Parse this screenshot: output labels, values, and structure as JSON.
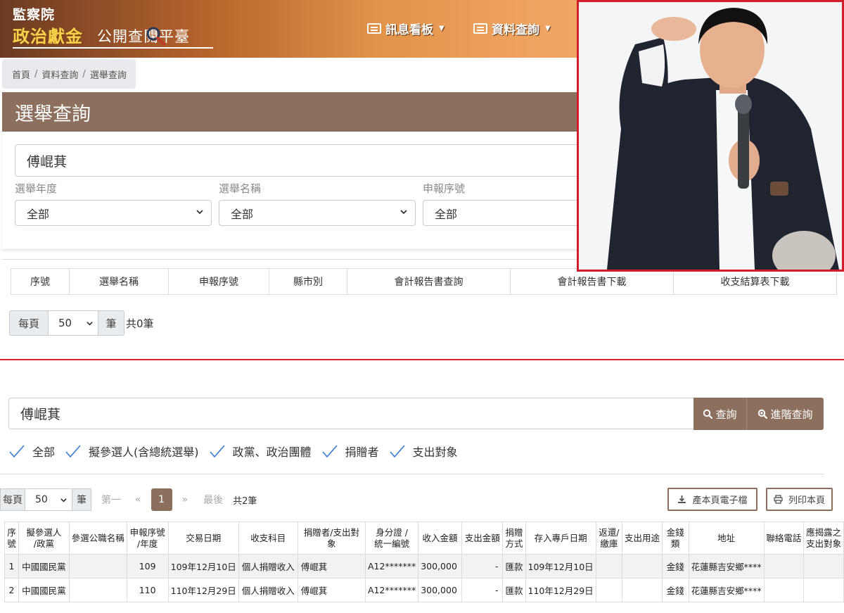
{
  "site": {
    "org": "監察院",
    "title_main": "政治獻金",
    "title_sub": "公開查閱平臺",
    "nav": [
      {
        "label": "訊息看板"
      },
      {
        "label": "資料查詢"
      }
    ]
  },
  "breadcrumb": [
    "首頁",
    "資料查詢",
    "選舉查詢"
  ],
  "election_page": {
    "title": "選舉查詢",
    "search_value": "傅崐萁",
    "filters": [
      {
        "label": "選舉年度",
        "value": "全部"
      },
      {
        "label": "選舉名稱",
        "value": "全部"
      },
      {
        "label": "申報序號",
        "value": "全部"
      }
    ],
    "table_headers": [
      "序號",
      "選舉名稱",
      "申報序號",
      "縣市別",
      "會計報告書查詢",
      "會計報告書下載",
      "收支結算表下載"
    ],
    "pager": {
      "per_page_label": "每頁",
      "per_page_value": "50",
      "unit": "筆",
      "total": "共0筆"
    }
  },
  "photo": {
    "description_icon": "portrait-photo"
  },
  "detail_page": {
    "search_value": "傅崐萁",
    "buttons": {
      "query": "查詢",
      "advanced": "進階查詢",
      "export": "產本頁電子檔",
      "print": "列印本頁"
    },
    "checks": [
      "全部",
      "擬參選人(含總統選舉)",
      "政黨、政治團體",
      "捐贈者",
      "支出對象"
    ],
    "pager": {
      "per_page_label": "每頁",
      "per_page_value": "50",
      "unit": "筆",
      "first": "第一",
      "prev": "«",
      "current": "1",
      "next": "»",
      "last": "最後",
      "total": "共2筆"
    },
    "table_headers": [
      "序\n號",
      "擬參選人\n/政黨",
      "參選公職名稱",
      "申報序號\n/年度",
      "交易日期",
      "收支科目",
      "捐贈者/支出對象",
      "身分證 /\n統一編號",
      "收入金額",
      "支出金額",
      "捐贈\n方式",
      "存入專戶日期",
      "返還/\n繳庫",
      "支出用途",
      "金錢\n類",
      "地址",
      "聯絡電話",
      "應揭露之\n支出對象"
    ],
    "rows": [
      {
        "no": "1",
        "party": "中國國民黨",
        "office": "",
        "serial": "109",
        "date": "109年12月10日",
        "subject": "個人捐贈收入",
        "donor": "傅崐萁",
        "id": "A12*******",
        "income": "300,000",
        "expense": "-",
        "method": "匯款",
        "deposit_date": "109年12月10日",
        "returned": "",
        "purpose": "",
        "money_type": "金錢",
        "address": "花蓮縣吉安鄉****",
        "phone": "",
        "disclose": ""
      },
      {
        "no": "2",
        "party": "中國國民黨",
        "office": "",
        "serial": "110",
        "date": "110年12月29日",
        "subject": "個人捐贈收入",
        "donor": "傅崐萁",
        "id": "A12*******",
        "income": "300,000",
        "expense": "-",
        "method": "匯款",
        "deposit_date": "110年12月29日",
        "returned": "",
        "purpose": "",
        "money_type": "金錢",
        "address": "花蓮縣吉安鄉****",
        "phone": "",
        "disclose": ""
      }
    ]
  },
  "colors": {
    "brand_brown": "#8d6f5e",
    "divider_red": "#d4202e",
    "check_blue": "#3b7bd0"
  }
}
